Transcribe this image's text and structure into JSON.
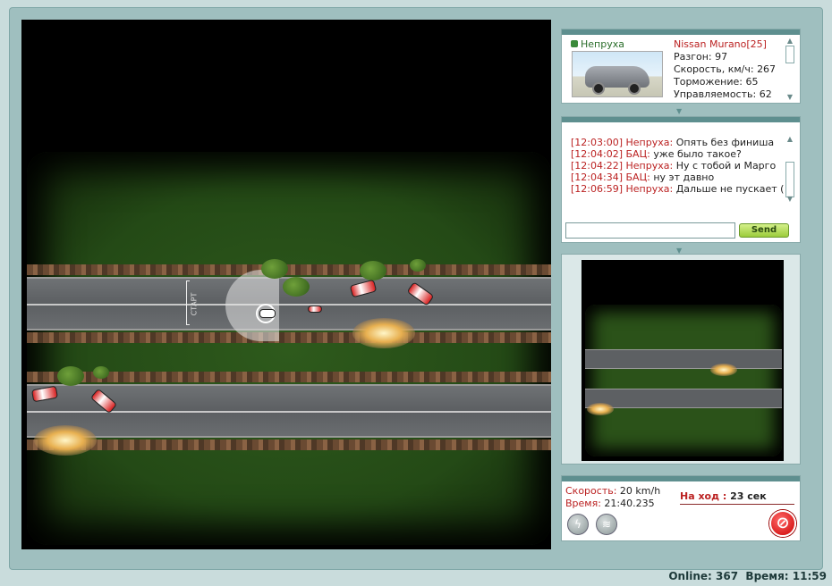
{
  "player": {
    "name": "Непруха",
    "car_model": "Nissan Murano[25]",
    "stats": [
      {
        "label": "Разгон:",
        "value": "97"
      },
      {
        "label": "Скорость, км/ч:",
        "value": "267"
      },
      {
        "label": "Торможение:",
        "value": "65"
      },
      {
        "label": "Управляемость:",
        "value": "62"
      }
    ]
  },
  "chat": {
    "messages": [
      {
        "time": "[12:03:00]",
        "nick": "Непруха:",
        "text": "Опять без финиша"
      },
      {
        "time": "[12:04:02]",
        "nick": "БАЦ:",
        "text": "уже было такое?"
      },
      {
        "time": "[12:04:22]",
        "nick": "Непруха:",
        "text": "Ну с тобой и Марго"
      },
      {
        "time": "[12:04:34]",
        "nick": "БАЦ:",
        "text": "ну эт давно"
      },
      {
        "time": "[12:06:59]",
        "nick": "Непруха:",
        "text": "Дальше не пускает ("
      }
    ],
    "input_value": "",
    "send_label": "Send"
  },
  "track": {
    "start_label": "СТАРТ"
  },
  "status": {
    "speed_label": "Скорость:",
    "speed_value": "20 km/h",
    "time_label": "Время:",
    "time_value": "21:40.235",
    "turn_label": "На ход :",
    "turn_value": "23 сек"
  },
  "footer": {
    "online_label": "Online:",
    "online_value": "367",
    "time_label": "Время:",
    "time_value": "11:59"
  },
  "colors": {
    "accent_red": "#b22222",
    "panel_teal": "#5e8f8f",
    "send_green": "#9ccc3c"
  }
}
